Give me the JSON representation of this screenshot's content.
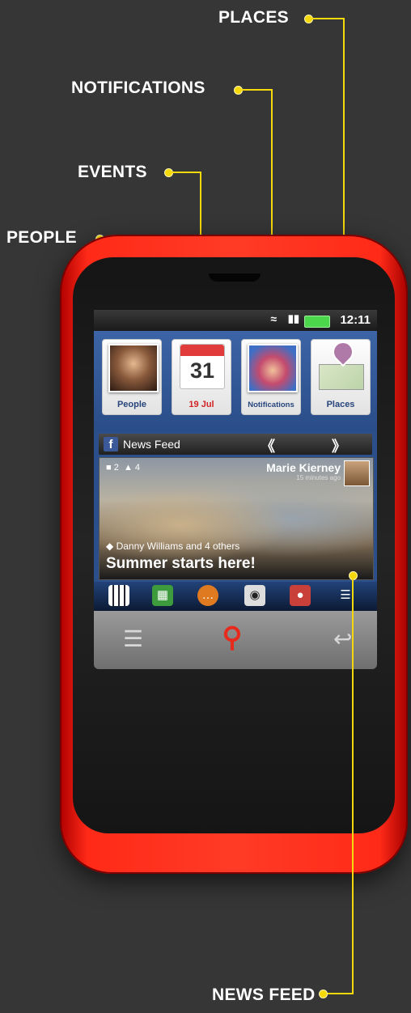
{
  "callouts": {
    "places": "PLACES",
    "notifications": "NOTIFICATIONS",
    "events": "EVENTS",
    "people": "PEOPLE",
    "news_feed": "NEWS FEED"
  },
  "status_bar": {
    "time": "12:11"
  },
  "tiles": {
    "people": {
      "label": "People"
    },
    "events": {
      "day": "31",
      "label": "19 Jul"
    },
    "notifications": {
      "label": "Notifications"
    },
    "places": {
      "label": "Places"
    }
  },
  "news_feed": {
    "title": "News Feed",
    "prev": "《",
    "next": "》",
    "comments": "2",
    "likes": "4",
    "author": "Marie Kierney",
    "time_ago": "15 minutes ago",
    "tagged": "Danny Williams and 4 others",
    "caption": "Summer starts here!"
  },
  "dock": {
    "items": [
      "apps-grid-icon",
      "contacts-icon",
      "messages-icon",
      "camera-icon",
      "browser-icon",
      "settings-icon"
    ]
  },
  "colors": {
    "phone_body": "#ff3b26",
    "callout_line": "#f5d90a",
    "screen_blue": "#2b4f8a"
  }
}
